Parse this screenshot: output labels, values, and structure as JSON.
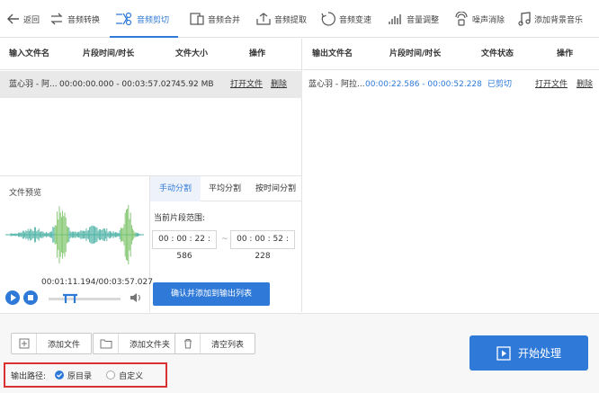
{
  "toolbar": {
    "items": [
      {
        "label": "返回",
        "icon": "back-arrow-icon"
      },
      {
        "label": "音频转换",
        "icon": "convert-arrows-icon"
      },
      {
        "label": "音频剪切",
        "icon": "scissors-icon"
      },
      {
        "label": "音频合并",
        "icon": "merge-icon"
      },
      {
        "label": "音频提取",
        "icon": "extract-icon"
      },
      {
        "label": "音频变速",
        "icon": "speed-icon"
      },
      {
        "label": "音量调整",
        "icon": "volume-bars-icon"
      },
      {
        "label": "噪声消除",
        "icon": "noise-icon"
      },
      {
        "label": "添加背景音乐",
        "icon": "music-note-icon"
      }
    ],
    "active_index": 2
  },
  "input_table": {
    "headers": [
      "输入文件名",
      "片段时间/时长",
      "文件大小",
      "操作"
    ],
    "rows": [
      {
        "name": "蓝心羽 - 阿...",
        "time": "00:00:00.000 - 00:03:57.027",
        "size": "45.92 MB",
        "open": "打开文件",
        "delete": "删除"
      }
    ]
  },
  "output_table": {
    "headers": [
      "输出文件名",
      "片段时间/时长",
      "文件状态",
      "操作"
    ],
    "rows": [
      {
        "name": "蓝心羽 - 阿拉...",
        "time": "00:00:22.586 - 00:00:52.228",
        "status": "已剪切",
        "open": "打开文件",
        "delete": "删除"
      }
    ]
  },
  "preview": {
    "label": "文件预览",
    "time_readout": "00:01:11.194/00:03:57.027",
    "progress": 0.3
  },
  "split": {
    "tabs": [
      "手动分割",
      "平均分割",
      "按时间分割"
    ],
    "active_tab": 0,
    "range_label": "当前片段范围:",
    "start_time": "00 : 00 : 22 : 586",
    "tilde": "~",
    "end_time": "00 : 00 : 52 : 228",
    "confirm_label": "确认并添加到输出列表"
  },
  "bottom": {
    "add_file": "添加文件",
    "add_folder": "添加文件夹",
    "clear_list": "清空列表",
    "start_label": "开始处理",
    "output_path_label": "输出路径:",
    "option_original": "原目录",
    "option_custom": "自定义",
    "selected_option": "原目录"
  },
  "colors": {
    "accent": "#2f7ad8",
    "highlight_border": "#d93232",
    "waveform_green": "#7cc46a",
    "waveform_teal": "#4fb3a6"
  }
}
